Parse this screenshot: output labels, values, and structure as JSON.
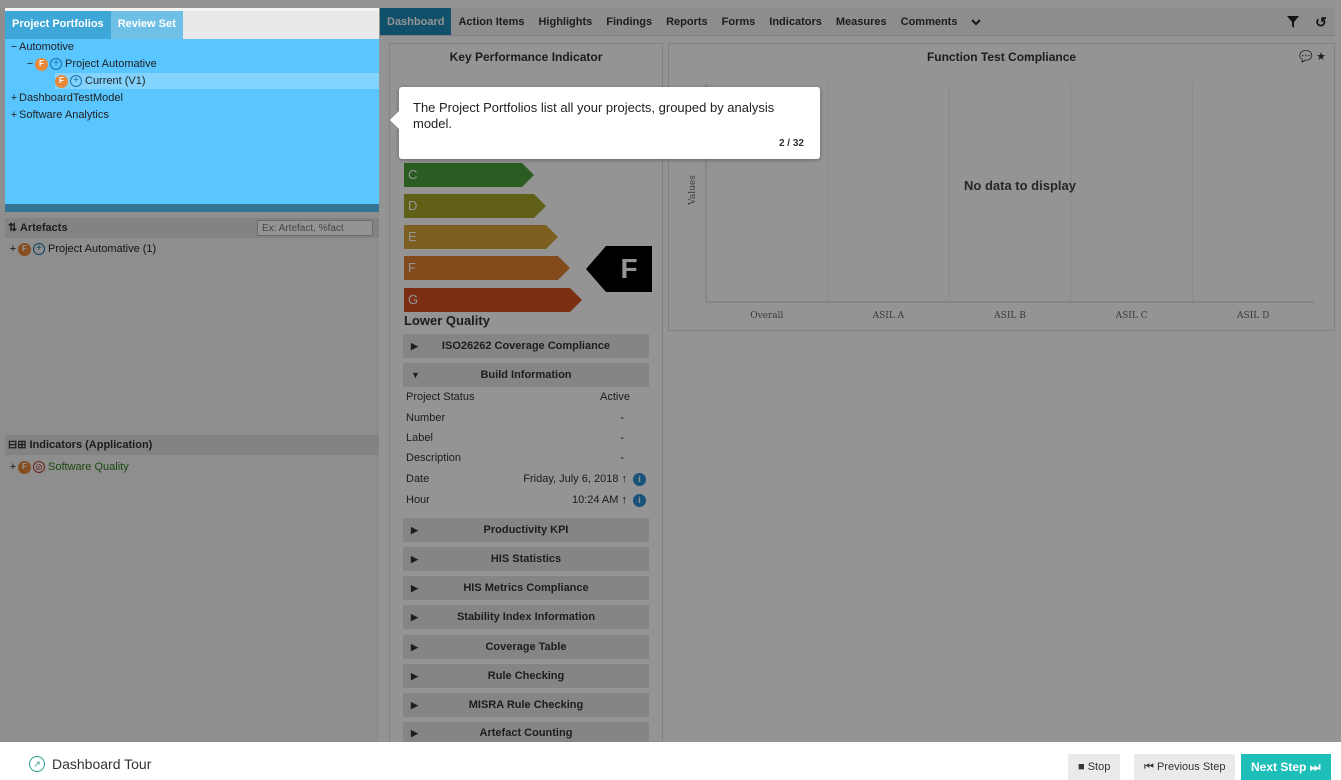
{
  "portfolio_tabs": [
    "Project Portfolios",
    "Review Set"
  ],
  "portfolio_tree": [
    {
      "expander": "−",
      "label": "Automotive"
    },
    {
      "expander": "−",
      "label": "Project Automative"
    },
    {
      "expander": "",
      "label": "Current (V1)"
    },
    {
      "expander": "+",
      "label": "DashboardTestModel"
    },
    {
      "expander": "+",
      "label": "Software Analytics"
    }
  ],
  "artefacts": {
    "title": "Artefacts",
    "filter_placeholder": "Ex: Artefact, %fact",
    "items": [
      {
        "expander": "+",
        "label": "Project Automative (1)"
      }
    ]
  },
  "indicators": {
    "title": "Indicators (Application)",
    "items": [
      {
        "expander": "+",
        "label": "Software Quality"
      }
    ]
  },
  "nav_tabs": [
    "Dashboard",
    "Action Items",
    "Highlights",
    "Findings",
    "Reports",
    "Forms",
    "Indicators",
    "Measures",
    "Comments"
  ],
  "kpi": {
    "title": "Key Performance Indicator",
    "grades": [
      {
        "letter": "C",
        "color": "#4aa03c"
      },
      {
        "letter": "D",
        "color": "#a6a828"
      },
      {
        "letter": "E",
        "color": "#d6a43a"
      },
      {
        "letter": "F",
        "color": "#e0802e"
      },
      {
        "letter": "G",
        "color": "#d4501e"
      }
    ],
    "current_grade": "F",
    "lower_quality": "Lower Quality",
    "sections": {
      "iso": "ISO26262 Coverage Compliance",
      "build": "Build Information",
      "productivity": "Productivity KPI",
      "his_stats": "HIS Statistics",
      "his_metrics": "HIS Metrics Compliance",
      "stability": "Stability Index Information",
      "coverage": "Coverage Table",
      "rule": "Rule Checking",
      "misra": "MISRA Rule Checking",
      "artefact_counting": "Artefact Counting"
    },
    "build_info": [
      {
        "label": "Project Status",
        "value": "Active"
      },
      {
        "label": "Number",
        "value": "-"
      },
      {
        "label": "Label",
        "value": "-"
      },
      {
        "label": "Description",
        "value": "-"
      },
      {
        "label": "Date",
        "value": "Friday, July 6, 2018 ↑"
      },
      {
        "label": "Hour",
        "value": "10:24 AM ↑"
      }
    ]
  },
  "chart_data": {
    "type": "bar",
    "title": "Function Test Compliance",
    "categories": [
      "Overall",
      "ASIL A",
      "ASIL B",
      "ASIL C",
      "ASIL D"
    ],
    "series": [],
    "ylabel": "Values",
    "empty_message": "No data to display"
  },
  "tooltip": {
    "text": "The Project Portfolios list all your projects, grouped by analysis model.",
    "step": "2 / 32"
  },
  "footer": {
    "tour_title": "Dashboard Tour",
    "stop": "Stop",
    "previous": "Previous Step",
    "next": "Next Step"
  }
}
